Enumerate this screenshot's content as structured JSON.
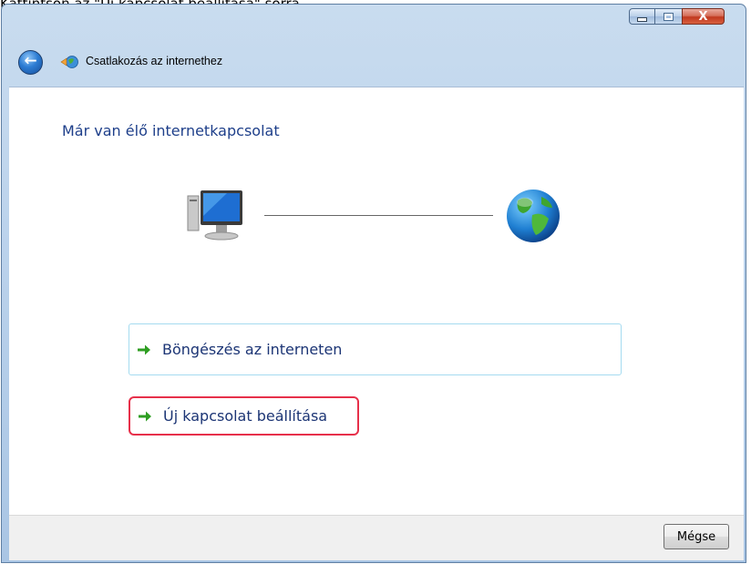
{
  "instruction": "Kattintson az \"Új kapcsolat beállítása\" sorra.",
  "window": {
    "title": "Csatlakozás az internethez",
    "controls": {
      "minimize": "minimize",
      "maximize": "maximize",
      "close": "X"
    }
  },
  "content": {
    "heading": "Már van élő internetkapcsolat",
    "options": [
      {
        "label": "Böngészés az interneten",
        "icon": "green-arrow-icon",
        "highlighted": false
      },
      {
        "label": "Új kapcsolat beállítása",
        "icon": "green-arrow-icon",
        "highlighted": true
      }
    ]
  },
  "footer": {
    "cancel_label": "Mégse"
  },
  "colors": {
    "heading": "#1e3f8a",
    "highlight_border": "#e7304a",
    "option_border": "#a5dbf0",
    "arrow": "#2f9e23"
  }
}
